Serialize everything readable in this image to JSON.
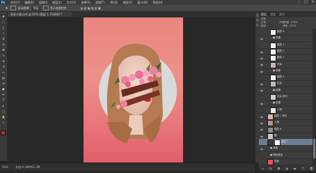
{
  "app": {
    "logo": "Ps",
    "menus": [
      "文件(F)",
      "编辑(E)",
      "图像(I)",
      "图层(L)",
      "文字(Y)",
      "选择(S)",
      "滤镜(T)",
      "3D(D)",
      "视图(V)",
      "窗口(W)",
      "帮助(H)"
    ],
    "window_controls": [
      "–",
      "□",
      "✕"
    ]
  },
  "options_bar": {
    "items": [
      "自动选择:",
      "图层",
      "显示变换控件"
    ]
  },
  "document_tab": {
    "label": "花朵人像.psd @ 50% (图层 1, RGB/8) *"
  },
  "toolbar": {
    "tools": [
      "move-icon",
      "marquee-icon",
      "lasso-icon",
      "magic-wand-icon",
      "crop-icon",
      "eyedropper-icon",
      "heal-icon",
      "brush-icon",
      "stamp-icon",
      "history-brush-icon",
      "eraser-icon",
      "gradient-icon",
      "blur-icon",
      "dodge-icon",
      "pen-icon",
      "type-icon",
      "path-select-icon",
      "shape-icon",
      "hand-icon",
      "zoom-icon"
    ],
    "glyphs": [
      "✥",
      "⬚",
      "ʆ",
      "✧",
      "⌗",
      "⊘",
      "✚",
      "✎",
      "⊕",
      "↺",
      "▭",
      "▤",
      "◔",
      "●",
      "✒",
      "T",
      "▸",
      "□",
      "✋",
      "⌕"
    ],
    "foreground_color": "#c8262c",
    "background_color": "#ffffff"
  },
  "status_bar": {
    "zoom": "50%",
    "doc_info": "文档:4.39M/61.2M"
  },
  "layers_panel": {
    "tabs": [
      "图层",
      "通道",
      "路径"
    ],
    "filter_label": "类型",
    "blend_mode": "正常",
    "opacity_label": "不透明度:",
    "opacity_value": "100%",
    "lock_label": "锁定:",
    "fill_label": "填充:",
    "fill_value": "100%",
    "layers": [
      {
        "name": "图层 4",
        "visible": true,
        "thumb": "#f2f2f2",
        "indent": 2,
        "selected": false,
        "has_mask": false
      },
      {
        "name": "● 效果",
        "visible": false,
        "thumb": "",
        "indent": 3,
        "selected": false,
        "has_mask": false
      },
      {
        "name": "图层 3",
        "visible": true,
        "thumb": "#f2f2f2",
        "indent": 2,
        "selected": false,
        "has_mask": false
      },
      {
        "name": "图层 2",
        "visible": true,
        "thumb": "#f2f2f2",
        "indent": 2,
        "selected": false,
        "has_mask": false
      },
      {
        "name": "图层 1",
        "visible": true,
        "thumb": "#f2f2f2",
        "indent": 2,
        "selected": false,
        "has_mask": false
      },
      {
        "name": "花朵",
        "visible": true,
        "thumb": "#c8b6b1",
        "indent": 2,
        "selected": false,
        "has_mask": false
      },
      {
        "name": "● 效果",
        "visible": false,
        "thumb": "",
        "indent": 3,
        "selected": false,
        "has_mask": false
      },
      {
        "name": "图层 5",
        "visible": true,
        "thumb": "#f2f2f2",
        "indent": 2,
        "selected": false,
        "has_mask": false
      },
      {
        "name": "花朵",
        "visible": true,
        "thumb": "#c9b5b0",
        "indent": 2,
        "selected": false,
        "has_mask": false
      },
      {
        "name": "● 效果",
        "visible": false,
        "thumb": "",
        "indent": 3,
        "selected": false,
        "has_mask": false
      },
      {
        "name": "花朵 拷贝",
        "visible": true,
        "thumb": "#d8c9c4",
        "indent": 2,
        "selected": false,
        "has_mask": false
      },
      {
        "name": "● 效果",
        "visible": false,
        "thumb": "",
        "indent": 3,
        "selected": false,
        "has_mask": false
      },
      {
        "name": "人物",
        "visible": true,
        "thumb": "#e9e9e9",
        "indent": 2,
        "selected": false,
        "has_mask": false
      },
      {
        "name": "图层 1 拷贝",
        "visible": true,
        "thumb": "#d7b7ad",
        "indent": 1,
        "selected": false,
        "has_mask": false
      },
      {
        "name": "人物",
        "visible": true,
        "thumb": "#b99488",
        "indent": 1,
        "selected": false,
        "has_mask": false
      },
      {
        "name": "图层 6",
        "visible": true,
        "thumb": "#8f8f8f",
        "indent": 1,
        "selected": false,
        "has_mask": false
      },
      {
        "name": "圆",
        "visible": true,
        "thumb": "#c8c8c8",
        "indent": 1,
        "selected": false,
        "has_mask": false
      },
      {
        "name": "图层 7",
        "visible": true,
        "thumb": "#3a3a3a",
        "indent": 1,
        "selected": true,
        "has_mask": true
      },
      {
        "name": "● 效果",
        "visible": false,
        "thumb": "",
        "indent": 2,
        "selected": false,
        "has_mask": false
      },
      {
        "name": "● 颜色叠加",
        "visible": false,
        "thumb": "",
        "indent": 2,
        "selected": false,
        "has_mask": false
      },
      {
        "name": "背景",
        "visible": true,
        "thumb": "#e4525c",
        "indent": 1,
        "selected": false,
        "has_mask": false
      }
    ],
    "footer_icons": [
      "link-icon",
      "fx-icon",
      "mask-icon",
      "adjustment-icon",
      "folder-icon",
      "new-layer-icon",
      "trash-icon"
    ],
    "footer_glyphs": [
      "∞",
      "fx",
      "◘",
      "◑",
      "▬",
      "❐",
      "🗑"
    ]
  }
}
